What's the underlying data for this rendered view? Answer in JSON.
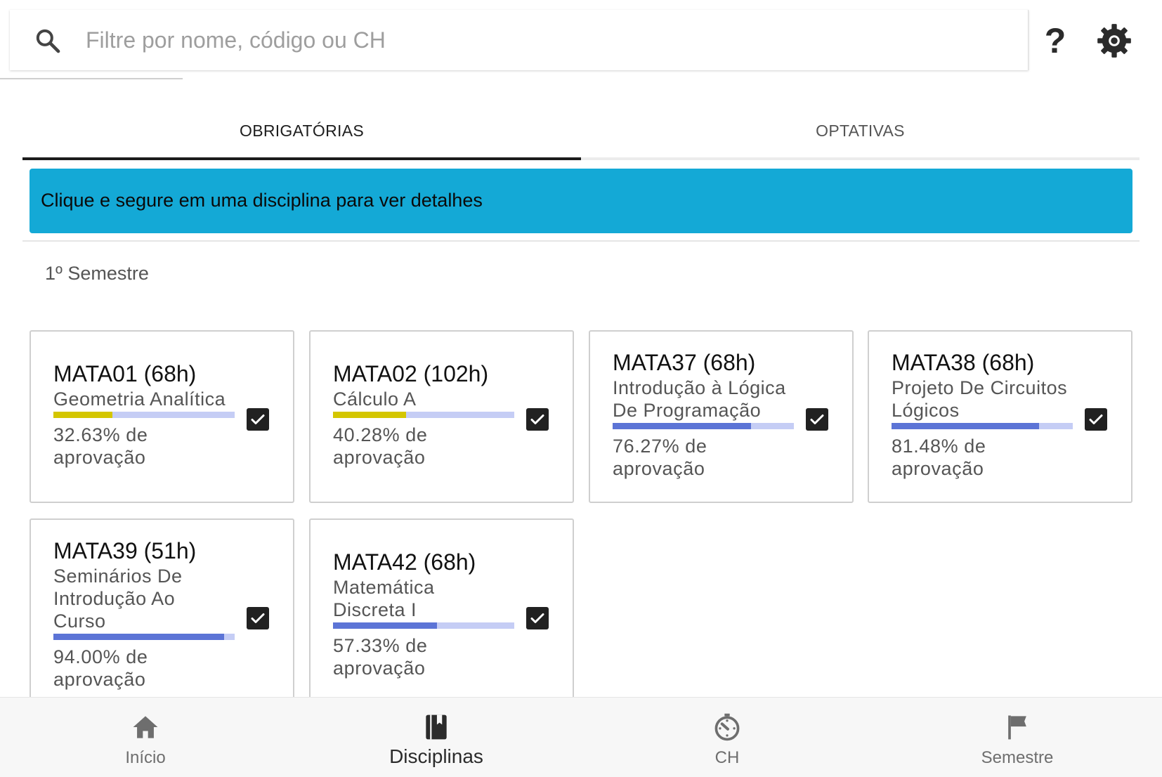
{
  "search": {
    "placeholder": "Filtre por nome, código ou CH",
    "value": ""
  },
  "header": {
    "help_icon": "help-icon",
    "help_symbol": "?",
    "settings_icon": "gear-icon"
  },
  "tabs": [
    {
      "label": "OBRIGATÓRIAS",
      "active": true
    },
    {
      "label": "OPTATIVAS",
      "active": false
    }
  ],
  "banner": {
    "text": "Clique e segure em uma disciplina para ver detalhes",
    "color": "#14a9d6"
  },
  "section": {
    "title": "1º Semestre"
  },
  "colors": {
    "progress_low": "#d4c600",
    "progress_high": "#5c74d6",
    "progress_track": "#c5cdf5"
  },
  "courses": [
    {
      "code": "MATA01 (68h)",
      "name_lines": [
        "Geometria Analítica"
      ],
      "approval_rate": 32.63,
      "approval_text": [
        "32.63% de",
        "aprovação"
      ],
      "checked": true
    },
    {
      "code": "MATA02 (102h)",
      "name_lines": [
        "Cálculo A"
      ],
      "approval_rate": 40.28,
      "approval_text": [
        "40.28% de",
        "aprovação"
      ],
      "checked": true
    },
    {
      "code": "MATA37 (68h)",
      "name_lines": [
        "Introdução à Lógica",
        "De Programação"
      ],
      "approval_rate": 76.27,
      "approval_text": [
        "76.27% de",
        "aprovação"
      ],
      "checked": true
    },
    {
      "code": "MATA38 (68h)",
      "name_lines": [
        "Projeto De Circuitos",
        "Lógicos"
      ],
      "approval_rate": 81.48,
      "approval_text": [
        "81.48% de",
        "aprovação"
      ],
      "checked": true
    },
    {
      "code": "MATA39 (51h)",
      "name_lines": [
        "Seminários De",
        "Introdução Ao",
        "Curso"
      ],
      "approval_rate": 94.0,
      "approval_text": [
        "94.00% de",
        "aprovação"
      ],
      "checked": true
    },
    {
      "code": "MATA42 (68h)",
      "name_lines": [
        "Matemática",
        "Discreta I"
      ],
      "approval_rate": 57.33,
      "approval_text": [
        "57.33% de",
        "aprovação"
      ],
      "checked": true
    }
  ],
  "bottom_nav": [
    {
      "label": "Início",
      "icon": "home-icon",
      "active": false
    },
    {
      "label": "Disciplinas",
      "icon": "book-icon",
      "active": true
    },
    {
      "label": "CH",
      "icon": "timer-icon",
      "active": false
    },
    {
      "label": "Semestre",
      "icon": "flag-icon",
      "active": false
    }
  ]
}
